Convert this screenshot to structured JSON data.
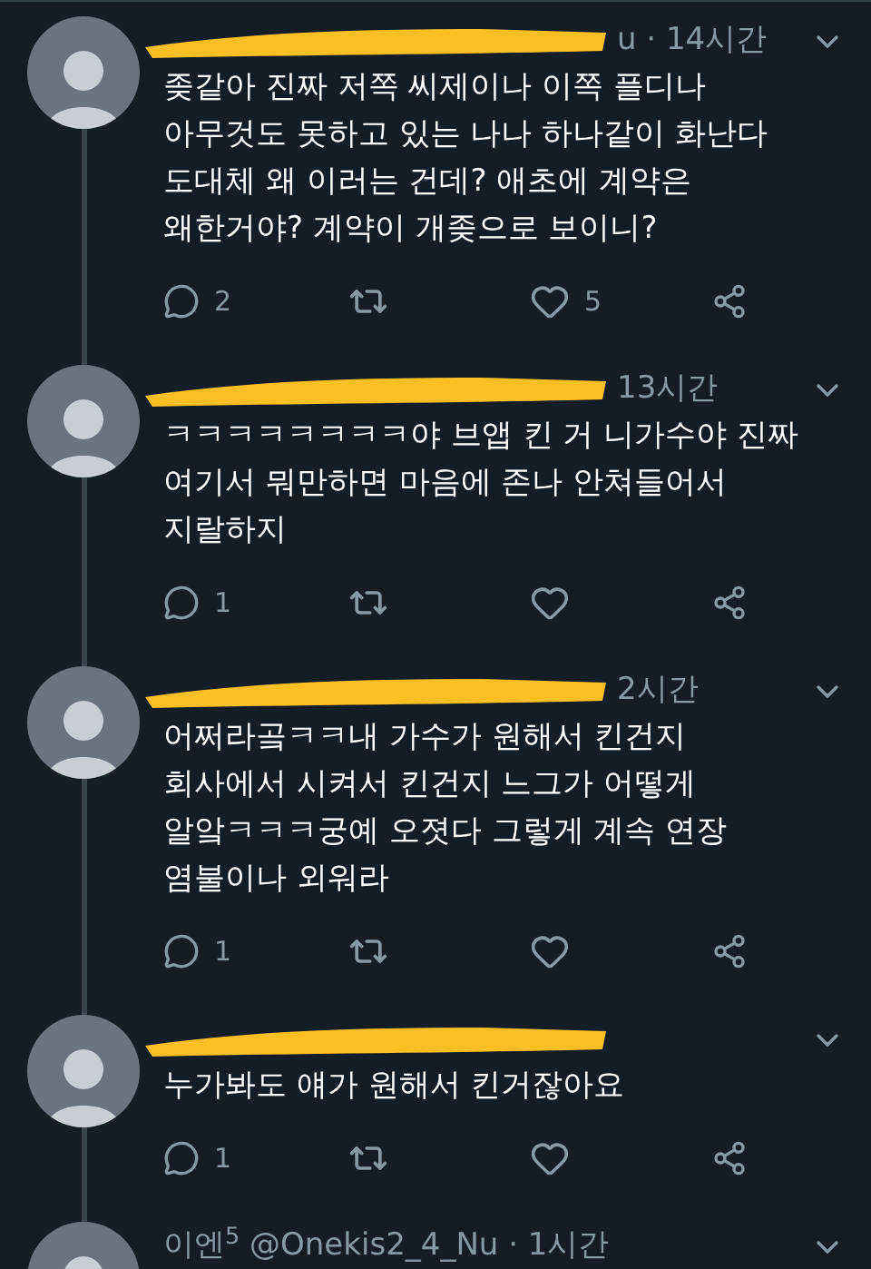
{
  "tweets": [
    {
      "header": "u · 14시간",
      "redacted": true,
      "text": "좆같아 진짜 저쪽 씨제이나 이쪽 플디나\n아무것도 못하고 있는 나나 하나같이 화난다\n도대체 왜 이러는 건데? 애초에 계약은\n왜한거야? 계약이 개좆으로 보이니?",
      "replies": "2",
      "likes": "5"
    },
    {
      "header": "13시간",
      "redacted": true,
      "text": "ㅋㅋㅋㅋㅋㅋㅋㅋ야 브앱 킨 거 니가수야 진짜\n여기서 뭐만하면 마음에 존나 안쳐들어서\n지랄하지",
      "replies": "1"
    },
    {
      "header": "2시간",
      "redacted": true,
      "text": "어쩌라곸ㅋㅋ내 가수가 원해서 킨건지\n회사에서 시켜서 킨건지 느그가 어떻게\n알앜ㅋㅋㅋ궁예 오졋다 그렇게 계속 연장\n염불이나 외워라",
      "replies": "1"
    },
    {
      "redacted": true,
      "text": "누가봐도 얘가 원해서 킨거잖아요",
      "replies": "1"
    },
    {
      "header": "이엔$^{5}$ @Onekis2_4_Nu · 1시간",
      "redacted": false
    }
  ]
}
